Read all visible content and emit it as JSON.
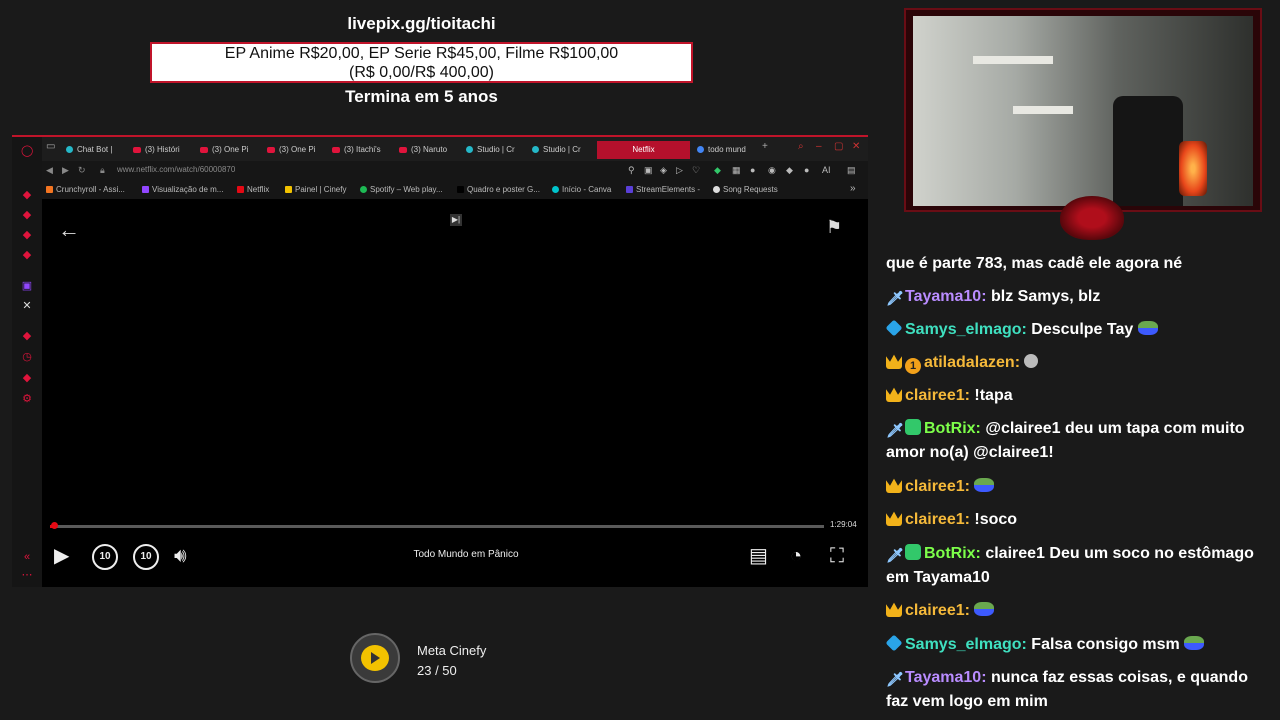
{
  "banner": {
    "title": "livepix.gg/tioitachi",
    "line1": "EP Anime R$20,00, EP Serie R$45,00, Filme R$100,00",
    "line2": "(R$ 0,00/R$ 400,00)",
    "footer": "Termina em 5 anos"
  },
  "browser": {
    "tabs": [
      {
        "label": "Chat Bot |",
        "icon": "bot"
      },
      {
        "label": "(3) Históri",
        "icon": "youtube"
      },
      {
        "label": "(3) One Pi",
        "icon": "youtube"
      },
      {
        "label": "(3) One Pi",
        "icon": "youtube"
      },
      {
        "label": "(3) Itachi's",
        "icon": "youtube"
      },
      {
        "label": "(3) Naruto",
        "icon": "youtube"
      },
      {
        "label": "Studio | Cr",
        "icon": "studio"
      },
      {
        "label": "Studio | Cr",
        "icon": "studio"
      },
      {
        "label": "Netflix",
        "icon": "netflix"
      },
      {
        "label": "todo mund",
        "icon": "google"
      }
    ],
    "new_tab": "+",
    "url": "www.netflix.com/watch/60000870",
    "bookmarks": [
      {
        "label": "Crunchyroll - Assi...",
        "color": "#f47521"
      },
      {
        "label": "Visualização de m...",
        "color": "#9146ff"
      },
      {
        "label": "Netflix",
        "color": "#e50914"
      },
      {
        "label": "Painel | Cinefy",
        "color": "#f2c200"
      },
      {
        "label": "Spotify – Web play...",
        "color": "#1db954"
      },
      {
        "label": "Quadro e poster G...",
        "color": "#000000"
      },
      {
        "label": "Início - Canva",
        "color": "#00c4cc"
      },
      {
        "label": "StreamElements -",
        "color": "#5a3fd8"
      },
      {
        "label": "Song Requests",
        "color": "#dddddd"
      }
    ],
    "toolbar_ai": "AI",
    "more": "»"
  },
  "player": {
    "title": "Todo Mundo em Pânico",
    "time_remaining": "1:29:04",
    "progress_fraction": 0.004,
    "rewind_label": "10",
    "forward_label": "10"
  },
  "meta": {
    "name": "Meta Cinefy",
    "count": "23 / 50",
    "accent": "#f2c200"
  },
  "chat": {
    "messages": [
      {
        "badges": [],
        "user": "",
        "text": "que é parte 783, mas cadê ele agora né",
        "user_color": "#ffffff"
      },
      {
        "badges": [
          "sword"
        ],
        "user": "Tayama10:",
        "text": " blz Samys, blz",
        "user_color": "#b98cff"
      },
      {
        "badges": [
          "cube"
        ],
        "user": "Samys_elmago:",
        "text": " Desculpe Tay ",
        "user_color": "#3fe0c0",
        "emote": "pepe"
      },
      {
        "badges": [
          "crown",
          "one"
        ],
        "user": "atiladalazen:",
        "text": " ",
        "user_color": "#f5b93a",
        "emote": "face"
      },
      {
        "badges": [
          "crown"
        ],
        "user": "clairee1:",
        "text": " !tapa",
        "user_color": "#f5b93a"
      },
      {
        "badges": [
          "sword",
          "bot"
        ],
        "user": "BotRix:",
        "text": " @clairee1 deu um tapa com muito amor no(a) @clairee1!",
        "user_color": "#7dff4a"
      },
      {
        "badges": [
          "crown"
        ],
        "user": "clairee1:",
        "text": " ",
        "user_color": "#f5b93a",
        "emote": "pepe"
      },
      {
        "badges": [
          "crown"
        ],
        "user": "clairee1:",
        "text": " !soco",
        "user_color": "#f5b93a"
      },
      {
        "badges": [
          "sword",
          "bot"
        ],
        "user": "BotRix:",
        "text": " clairee1 Deu um soco no estômago em Tayama10",
        "user_color": "#7dff4a"
      },
      {
        "badges": [
          "crown"
        ],
        "user": "clairee1:",
        "text": " ",
        "user_color": "#f5b93a",
        "emote": "pepe"
      },
      {
        "badges": [
          "cube"
        ],
        "user": "Samys_elmago:",
        "text": " Falsa consigo msm ",
        "user_color": "#3fe0c0",
        "emote": "pepe"
      },
      {
        "badges": [
          "sword"
        ],
        "user": "Tayama10:",
        "text": " nunca faz essas coisas, e quando faz vem logo em mim",
        "user_color": "#b98cff"
      }
    ]
  },
  "colors": {
    "background": "#1a1a1a",
    "accent_red": "#c0142a",
    "netflix_red": "#e50914"
  }
}
